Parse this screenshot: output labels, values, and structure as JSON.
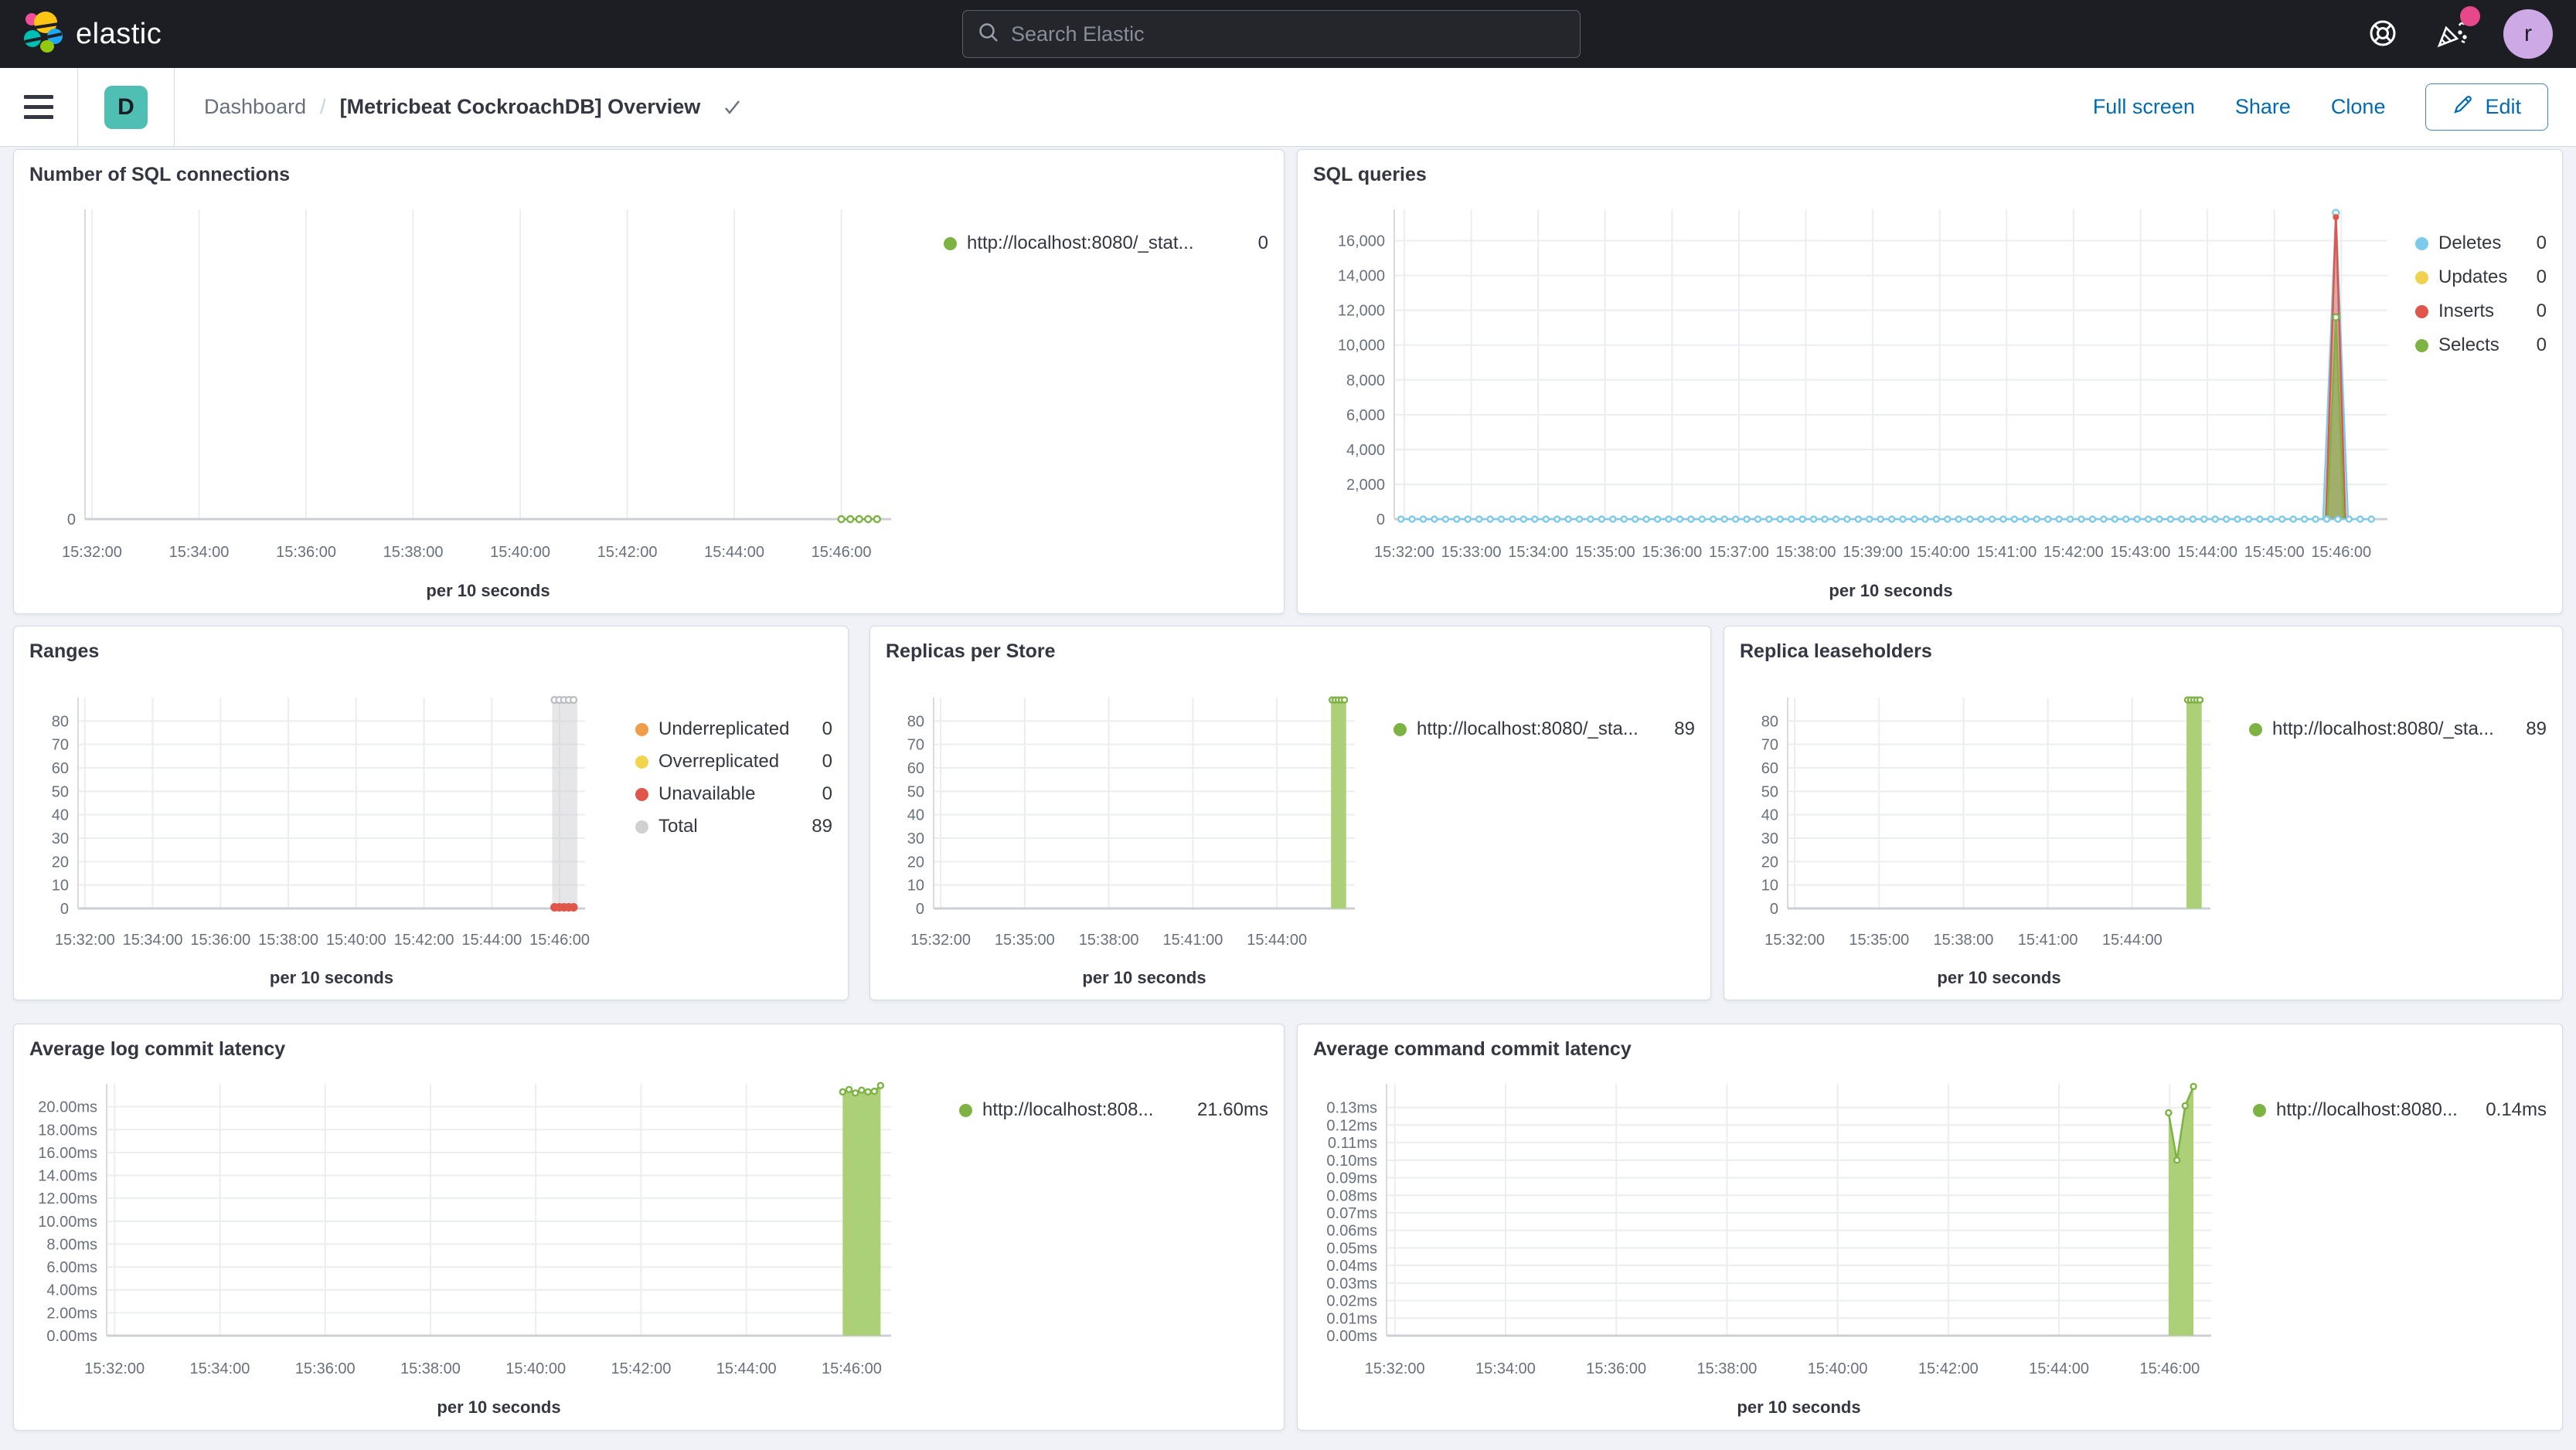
{
  "header": {
    "logo_text": "elastic",
    "search_placeholder": "Search Elastic",
    "avatar_initial": "r"
  },
  "toolbar": {
    "dashboard_initial": "D",
    "breadcrumb_root": "Dashboard",
    "breadcrumb_sep": "/",
    "title": "[Metricbeat CockroachDB] Overview",
    "actions": {
      "full_screen": "Full screen",
      "share": "Share",
      "clone": "Clone",
      "edit": "Edit"
    }
  },
  "colors": {
    "header_bg": "#1d1e24",
    "link_blue": "#006bb4",
    "tile_teal": "#4fbeb3",
    "avatar_purple": "#cda9e6",
    "badge_pink": "#e7478b",
    "series_green": "#7cb342",
    "series_blue": "#7dcbec",
    "series_red": "#e0564b",
    "series_yellow": "#efd24d",
    "series_orange": "#ee9d49",
    "series_gray": "#d0d0d3"
  },
  "chart_data": [
    {
      "id": "number-of-sql-connections",
      "type": "line",
      "title": "Number of SQL connections",
      "xlabel": "per 10 seconds",
      "x_domain": [
        31.87,
        46.93
      ],
      "y_domain": [
        0,
        1
      ],
      "x_ticks": [
        {
          "x": 32,
          "label": "15:32:00"
        },
        {
          "x": 34,
          "label": "15:34:00"
        },
        {
          "x": 36,
          "label": "15:36:00"
        },
        {
          "x": 38,
          "label": "15:38:00"
        },
        {
          "x": 40,
          "label": "15:40:00"
        },
        {
          "x": 42,
          "label": "15:42:00"
        },
        {
          "x": 44,
          "label": "15:44:00"
        },
        {
          "x": 46,
          "label": "15:46:00"
        }
      ],
      "y_ticks": [
        {
          "y": 0,
          "label": "0"
        }
      ],
      "legend": [
        {
          "label": "http://localhost:8080/_stat...",
          "value": "0",
          "color": "#7cb342"
        }
      ],
      "series": [
        {
          "name": "http://localhost:8080/_stat...",
          "type": "line",
          "color": "#7cb342",
          "marker": "open",
          "marker_r": 4,
          "points": [
            [
              46.0,
              0
            ],
            [
              46.167,
              0
            ],
            [
              46.333,
              0
            ],
            [
              46.5,
              0
            ],
            [
              46.667,
              0
            ]
          ]
        }
      ]
    },
    {
      "id": "sql-queries",
      "type": "area",
      "title": "SQL queries",
      "xlabel": "per 10 seconds",
      "x_domain": [
        31.85,
        46.69
      ],
      "y_domain": [
        0,
        17800
      ],
      "x_ticks": [
        {
          "x": 32,
          "label": "15:32:00"
        },
        {
          "x": 33,
          "label": "15:33:00"
        },
        {
          "x": 34,
          "label": "15:34:00"
        },
        {
          "x": 35,
          "label": "15:35:00"
        },
        {
          "x": 36,
          "label": "15:36:00"
        },
        {
          "x": 37,
          "label": "15:37:00"
        },
        {
          "x": 38,
          "label": "15:38:00"
        },
        {
          "x": 39,
          "label": "15:39:00"
        },
        {
          "x": 40,
          "label": "15:40:00"
        },
        {
          "x": 41,
          "label": "15:41:00"
        },
        {
          "x": 42,
          "label": "15:42:00"
        },
        {
          "x": 43,
          "label": "15:43:00"
        },
        {
          "x": 44,
          "label": "15:44:00"
        },
        {
          "x": 45,
          "label": "15:45:00"
        },
        {
          "x": 46,
          "label": "15:46:00"
        }
      ],
      "y_ticks": [
        {
          "y": 0,
          "label": "0"
        },
        {
          "y": 2000,
          "label": "2,000"
        },
        {
          "y": 4000,
          "label": "4,000"
        },
        {
          "y": 6000,
          "label": "6,000"
        },
        {
          "y": 8000,
          "label": "8,000"
        },
        {
          "y": 10000,
          "label": "10,000"
        },
        {
          "y": 12000,
          "label": "12,000"
        },
        {
          "y": 14000,
          "label": "14,000"
        },
        {
          "y": 16000,
          "label": "16,000"
        }
      ],
      "legend": [
        {
          "label": "Deletes",
          "value": "0",
          "color": "#7dcbec"
        },
        {
          "label": "Updates",
          "value": "0",
          "color": "#efd24d"
        },
        {
          "label": "Inserts",
          "value": "0",
          "color": "#e0564b"
        },
        {
          "label": "Selects",
          "value": "0",
          "color": "#7cb342"
        }
      ],
      "series": [
        {
          "name": "Deletes spike",
          "type": "area",
          "color": "#7dcbec",
          "fill": "rgba(125,203,236,0.30)",
          "points": [
            [
              45.73,
              0
            ],
            [
              45.92,
              17600
            ],
            [
              46.1,
              0
            ]
          ]
        },
        {
          "name": "Inserts spike",
          "type": "area",
          "color": "#e0564b",
          "fill": "rgba(224,86,75,0.45)",
          "points": [
            [
              45.77,
              0
            ],
            [
              45.92,
              17350
            ],
            [
              46.06,
              0
            ]
          ]
        },
        {
          "name": "Selects spike",
          "type": "area",
          "color": "#7cb342",
          "fill": "rgba(124,179,66,0.60)",
          "points": [
            [
              45.79,
              0
            ],
            [
              45.92,
              11600
            ],
            [
              46.04,
              0
            ]
          ]
        },
        {
          "name": "Deletes",
          "type": "line",
          "color": "#7dcbec",
          "marker": "open",
          "marker_r": 3.5,
          "baseline": {
            "from": 31.95,
            "to": 46.5,
            "step": 0.16667,
            "value": 0
          }
        },
        {
          "name": "Deletes peak",
          "type": "markers",
          "marker": "open",
          "marker_r": 4,
          "color": "#7dcbec",
          "points": [
            [
              45.92,
              17600
            ]
          ]
        },
        {
          "name": "Inserts peak",
          "type": "markers",
          "marker": "solid",
          "marker_r": 4,
          "color": "#e0564b",
          "points": [
            [
              45.92,
              17350
            ]
          ]
        },
        {
          "name": "Selects peak",
          "type": "markers",
          "marker": "open",
          "marker_r": 4,
          "color": "#7cb342",
          "points": [
            [
              45.92,
              11600
            ]
          ]
        }
      ]
    },
    {
      "id": "ranges",
      "type": "bar",
      "title": "Ranges",
      "xlabel": "per 10 seconds",
      "x_domain": [
        31.8,
        46.75
      ],
      "y_domain": [
        0,
        90
      ],
      "x_ticks": [
        {
          "x": 32,
          "label": "15:32:00"
        },
        {
          "x": 34,
          "label": "15:34:00"
        },
        {
          "x": 36,
          "label": "15:36:00"
        },
        {
          "x": 38,
          "label": "15:38:00"
        },
        {
          "x": 40,
          "label": "15:40:00"
        },
        {
          "x": 42,
          "label": "15:42:00"
        },
        {
          "x": 44,
          "label": "15:44:00"
        },
        {
          "x": 46,
          "label": "15:46:00"
        }
      ],
      "y_ticks": [
        {
          "y": 0,
          "label": "0"
        },
        {
          "y": 10,
          "label": "10"
        },
        {
          "y": 20,
          "label": "20"
        },
        {
          "y": 30,
          "label": "30"
        },
        {
          "y": 40,
          "label": "40"
        },
        {
          "y": 50,
          "label": "50"
        },
        {
          "y": 60,
          "label": "60"
        },
        {
          "y": 70,
          "label": "70"
        },
        {
          "y": 80,
          "label": "80"
        }
      ],
      "legend": [
        {
          "label": "Underreplicated",
          "value": "0",
          "color": "#ee9d49"
        },
        {
          "label": "Overreplicated",
          "value": "0",
          "color": "#f2d54e"
        },
        {
          "label": "Unavailable",
          "value": "0",
          "color": "#e0564b"
        },
        {
          "label": "Total",
          "value": "89",
          "color": "#d0d0d3"
        }
      ],
      "series": [
        {
          "name": "Total",
          "type": "band",
          "x1": 45.78,
          "x2": 46.52,
          "value": 89,
          "fill": "rgba(206,206,209,0.50)"
        },
        {
          "name": "Total points",
          "type": "markers",
          "marker": "open",
          "marker_r": 4,
          "color": "#bdbfc4",
          "points": [
            [
              45.85,
              89
            ],
            [
              45.99,
              89
            ],
            [
              46.13,
              89
            ],
            [
              46.27,
              89
            ],
            [
              46.41,
              89
            ]
          ]
        },
        {
          "name": "Unavailable",
          "type": "markers",
          "marker": "solid",
          "marker_r": 5.5,
          "color": "#e0564b",
          "points": [
            [
              45.85,
              0.5
            ],
            [
              45.99,
              0.5
            ],
            [
              46.13,
              0.5
            ],
            [
              46.27,
              0.5
            ],
            [
              46.41,
              0.5
            ]
          ]
        }
      ]
    },
    {
      "id": "replicas-per-store",
      "type": "bar",
      "title": "Replicas per Store",
      "xlabel": "per 10 seconds",
      "x_domain": [
        31.75,
        46.78
      ],
      "y_domain": [
        0,
        90
      ],
      "x_ticks": [
        {
          "x": 32,
          "label": "15:32:00"
        },
        {
          "x": 35,
          "label": "15:35:00"
        },
        {
          "x": 38,
          "label": "15:38:00"
        },
        {
          "x": 41,
          "label": "15:41:00"
        },
        {
          "x": 44,
          "label": "15:44:00"
        }
      ],
      "y_ticks": [
        {
          "y": 0,
          "label": "0"
        },
        {
          "y": 10,
          "label": "10"
        },
        {
          "y": 20,
          "label": "20"
        },
        {
          "y": 30,
          "label": "30"
        },
        {
          "y": 40,
          "label": "40"
        },
        {
          "y": 50,
          "label": "50"
        },
        {
          "y": 60,
          "label": "60"
        },
        {
          "y": 70,
          "label": "70"
        },
        {
          "y": 80,
          "label": "80"
        }
      ],
      "legend": [
        {
          "label": "http://localhost:8080/_sta...",
          "value": "89",
          "color": "#7cb342"
        }
      ],
      "series": [
        {
          "name": "http://localhost:8080/_sta...",
          "type": "band",
          "x1": 45.93,
          "x2": 46.47,
          "value": 89,
          "fill": "#abd077"
        },
        {
          "name": "points",
          "type": "markers",
          "marker": "open",
          "marker_r": 3.5,
          "color": "#7cb342",
          "points": [
            [
              45.97,
              89
            ],
            [
              46.08,
              89
            ],
            [
              46.19,
              89
            ],
            [
              46.3,
              89
            ],
            [
              46.41,
              89
            ]
          ]
        }
      ]
    },
    {
      "id": "replica-leaseholders",
      "type": "bar",
      "title": "Replica leaseholders",
      "xlabel": "per 10 seconds",
      "x_domain": [
        31.75,
        46.78
      ],
      "y_domain": [
        0,
        90
      ],
      "x_ticks": [
        {
          "x": 32,
          "label": "15:32:00"
        },
        {
          "x": 35,
          "label": "15:35:00"
        },
        {
          "x": 38,
          "label": "15:38:00"
        },
        {
          "x": 41,
          "label": "15:41:00"
        },
        {
          "x": 44,
          "label": "15:44:00"
        }
      ],
      "y_ticks": [
        {
          "y": 0,
          "label": "0"
        },
        {
          "y": 10,
          "label": "10"
        },
        {
          "y": 20,
          "label": "20"
        },
        {
          "y": 30,
          "label": "30"
        },
        {
          "y": 40,
          "label": "40"
        },
        {
          "y": 50,
          "label": "50"
        },
        {
          "y": 60,
          "label": "60"
        },
        {
          "y": 70,
          "label": "70"
        },
        {
          "y": 80,
          "label": "80"
        }
      ],
      "legend": [
        {
          "label": "http://localhost:8080/_sta...",
          "value": "89",
          "color": "#7cb342"
        }
      ],
      "series": [
        {
          "name": "http://localhost:8080/_sta...",
          "type": "band",
          "x1": 45.93,
          "x2": 46.47,
          "value": 89,
          "fill": "#abd077"
        },
        {
          "name": "points",
          "type": "markers",
          "marker": "open",
          "marker_r": 3.5,
          "color": "#7cb342",
          "points": [
            [
              45.97,
              89
            ],
            [
              46.08,
              89
            ],
            [
              46.19,
              89
            ],
            [
              46.3,
              89
            ],
            [
              46.41,
              89
            ]
          ]
        }
      ]
    },
    {
      "id": "average-log-commit-latency",
      "type": "area",
      "title": "Average log commit latency",
      "xlabel": "per 10 seconds",
      "x_domain": [
        31.85,
        46.75
      ],
      "y_domain": [
        0,
        22
      ],
      "x_ticks": [
        {
          "x": 32,
          "label": "15:32:00"
        },
        {
          "x": 34,
          "label": "15:34:00"
        },
        {
          "x": 36,
          "label": "15:36:00"
        },
        {
          "x": 38,
          "label": "15:38:00"
        },
        {
          "x": 40,
          "label": "15:40:00"
        },
        {
          "x": 42,
          "label": "15:42:00"
        },
        {
          "x": 44,
          "label": "15:44:00"
        },
        {
          "x": 46,
          "label": "15:46:00"
        }
      ],
      "y_ticks": [
        {
          "y": 0,
          "label": "0.00ms"
        },
        {
          "y": 2,
          "label": "2.00ms"
        },
        {
          "y": 4,
          "label": "4.00ms"
        },
        {
          "y": 6,
          "label": "6.00ms"
        },
        {
          "y": 8,
          "label": "8.00ms"
        },
        {
          "y": 10,
          "label": "10.00ms"
        },
        {
          "y": 12,
          "label": "12.00ms"
        },
        {
          "y": 14,
          "label": "14.00ms"
        },
        {
          "y": 16,
          "label": "16.00ms"
        },
        {
          "y": 18,
          "label": "18.00ms"
        },
        {
          "y": 20,
          "label": "20.00ms"
        }
      ],
      "legend": [
        {
          "label": "http://localhost:808...",
          "value": "21.60ms",
          "color": "#7cb342"
        }
      ],
      "series": [
        {
          "name": "http://localhost:808...",
          "type": "area",
          "color": "#7cb342",
          "fill": "#abd077",
          "marker": "open",
          "marker_r": 3.5,
          "points": [
            [
              45.83,
              21.3
            ],
            [
              45.95,
              21.5
            ],
            [
              46.07,
              21.2
            ],
            [
              46.19,
              21.45
            ],
            [
              46.31,
              21.3
            ],
            [
              46.43,
              21.35
            ],
            [
              46.55,
              21.85
            ]
          ]
        }
      ]
    },
    {
      "id": "average-command-commit-latency",
      "type": "area",
      "title": "Average command commit latency",
      "xlabel": "per 10 seconds",
      "x_domain": [
        31.85,
        46.75
      ],
      "y_domain": [
        0,
        0.1435
      ],
      "x_ticks": [
        {
          "x": 32,
          "label": "15:32:00"
        },
        {
          "x": 34,
          "label": "15:34:00"
        },
        {
          "x": 36,
          "label": "15:36:00"
        },
        {
          "x": 38,
          "label": "15:38:00"
        },
        {
          "x": 40,
          "label": "15:40:00"
        },
        {
          "x": 42,
          "label": "15:42:00"
        },
        {
          "x": 44,
          "label": "15:44:00"
        },
        {
          "x": 46,
          "label": "15:46:00"
        }
      ],
      "y_ticks": [
        {
          "y": 0,
          "label": "0.00ms"
        },
        {
          "y": 0.01,
          "label": "0.01ms"
        },
        {
          "y": 0.02,
          "label": "0.02ms"
        },
        {
          "y": 0.03,
          "label": "0.03ms"
        },
        {
          "y": 0.04,
          "label": "0.04ms"
        },
        {
          "y": 0.05,
          "label": "0.05ms"
        },
        {
          "y": 0.06,
          "label": "0.06ms"
        },
        {
          "y": 0.07,
          "label": "0.07ms"
        },
        {
          "y": 0.08,
          "label": "0.08ms"
        },
        {
          "y": 0.09,
          "label": "0.09ms"
        },
        {
          "y": 0.1,
          "label": "0.10ms"
        },
        {
          "y": 0.11,
          "label": "0.11ms"
        },
        {
          "y": 0.12,
          "label": "0.12ms"
        },
        {
          "y": 0.13,
          "label": "0.13ms"
        }
      ],
      "legend": [
        {
          "label": "http://localhost:8080...",
          "value": "0.14ms",
          "color": "#7cb342"
        }
      ],
      "series": [
        {
          "name": "http://localhost:8080...",
          "type": "area",
          "color": "#7cb342",
          "fill": "#abd077",
          "marker": "open",
          "marker_r": 3.5,
          "points": [
            [
              45.98,
              0.127
            ],
            [
              46.13,
              0.1
            ],
            [
              46.28,
              0.131
            ],
            [
              46.43,
              0.142
            ]
          ]
        }
      ]
    }
  ]
}
